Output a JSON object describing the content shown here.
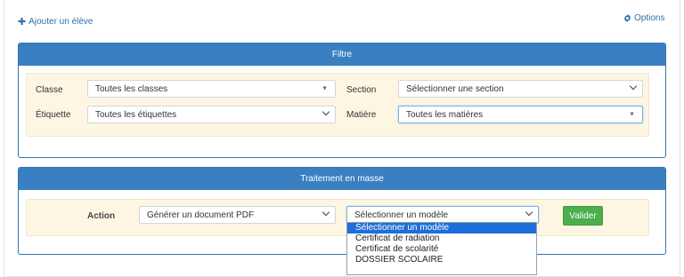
{
  "links": {
    "add_student": "Ajouter un élève",
    "options": "Options"
  },
  "filter": {
    "title": "Filtre",
    "classe_label": "Classe",
    "classe_value": "Toutes les classes",
    "section_label": "Section",
    "section_value": "Sélectionner une section",
    "etiquette_label": "Étiquette",
    "etiquette_value": "Toutes les étiquettes",
    "matiere_label": "Matière",
    "matiere_value": "Toutes les matières"
  },
  "mass": {
    "title": "Traitement en masse",
    "action_label": "Action",
    "action_value": "Générer un document PDF",
    "model_value": "Sélectionner un modèle",
    "validate_label": "Valider"
  },
  "model_options": [
    "Sélectionner un modèle",
    "Certificat de radiation",
    "Certificat de scolarité",
    "DOSSIER SCOLAIRE"
  ],
  "colors": {
    "panel_header": "#3a7fc1",
    "panel_body": "#fdf6e3",
    "link": "#2f6fa8",
    "validate_button": "#4cae4c",
    "dropdown_highlight": "#1e6fd9"
  },
  "icons": {
    "add": "plus-icon",
    "options": "gear-icon"
  }
}
